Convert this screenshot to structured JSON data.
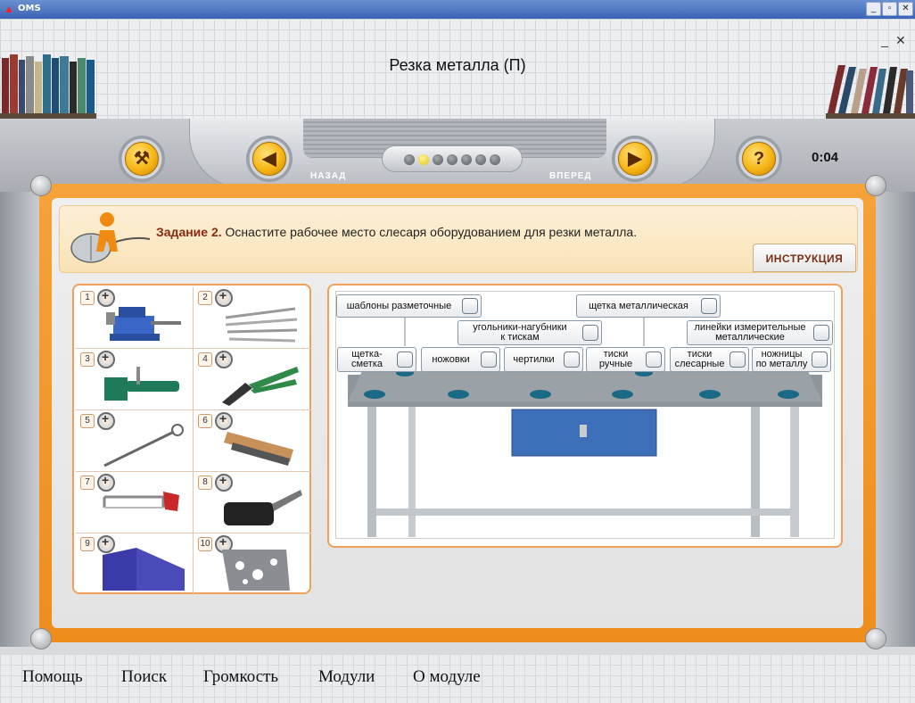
{
  "window": {
    "app_name": "OMS"
  },
  "header": {
    "title": "Резка металла (П)"
  },
  "toolbar": {
    "back_label": "НАЗАД",
    "forward_label": "ВПЕРЕД",
    "timer": "0:04",
    "progress_dots": 7,
    "active_dot": 2
  },
  "task": {
    "title": "Задание 2.",
    "text": " Оснастите рабочее место слесаря оборудованием для резки металла.",
    "instructions_label": "ИНСТРУКЦИЯ"
  },
  "tools": [
    "1",
    "2",
    "3",
    "4",
    "5",
    "6",
    "7",
    "8",
    "9",
    "10"
  ],
  "bench_labels": {
    "templates": "шаблоны разметочные",
    "wire_brush": "щетка металлическая",
    "vise_jaws_1": "угольники-нагубники",
    "vise_jaws_2": "к тискам",
    "rulers_1": "линейки измерительные",
    "rulers_2": "металлические",
    "brush_1": "щетка-",
    "brush_2": "сметка",
    "hacksaws": "ножовки",
    "scribers": "чертилки",
    "hand_vise_1": "тиски",
    "hand_vise_2": "ручные",
    "bench_vise_1": "тиски",
    "bench_vise_2": "слесарные",
    "shears_1": "ножницы",
    "shears_2": "по металлу"
  },
  "menu": [
    "Помощь",
    "Поиск",
    "Громкость",
    "Модули",
    "О модуле"
  ],
  "colors": {
    "frame": "#f09a2a",
    "accent_button": "#f7b515",
    "task_title": "#8a2a10"
  }
}
